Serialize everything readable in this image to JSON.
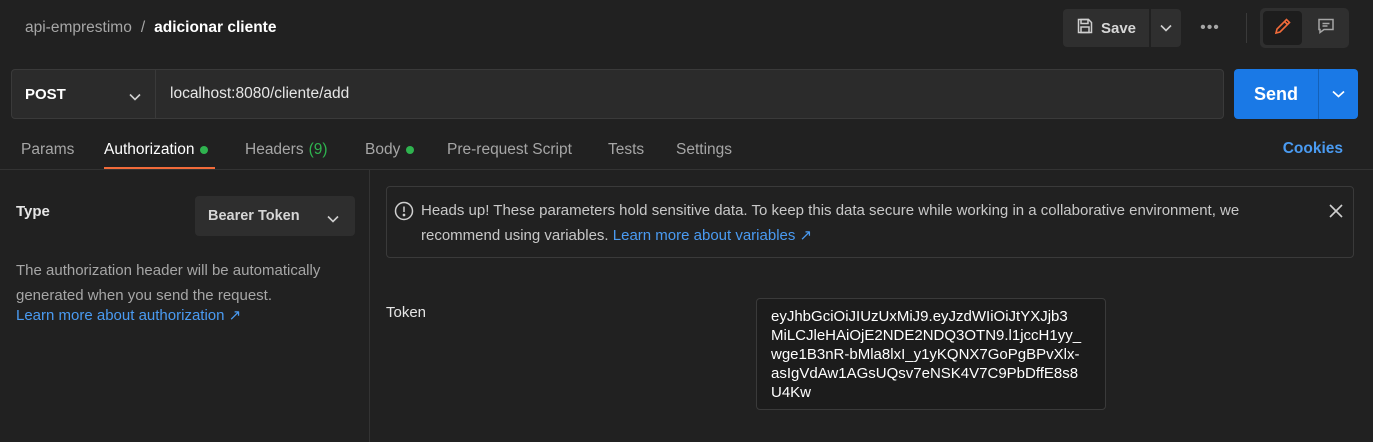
{
  "breadcrumb": {
    "parent": "api-emprestimo",
    "separator": "/",
    "current": "adicionar cliente"
  },
  "toolbar": {
    "save_label": "Save",
    "more_label": "•••"
  },
  "request": {
    "method": "POST",
    "url": "localhost:8080/cliente/add",
    "send_label": "Send"
  },
  "tabs": [
    {
      "label": "Params"
    },
    {
      "label": "Authorization",
      "dot": true
    },
    {
      "label": "Headers",
      "count": "(9)"
    },
    {
      "label": "Body",
      "dot": true
    },
    {
      "label": "Pre-request Script"
    },
    {
      "label": "Tests"
    },
    {
      "label": "Settings"
    }
  ],
  "cookies_label": "Cookies",
  "auth": {
    "type_label": "Type",
    "type_value": "Bearer Token",
    "description": "The authorization header will be automatically generated when you send the request.",
    "learn_link": "Learn more about authorization ↗"
  },
  "alert": {
    "text": "Heads up! These parameters hold sensitive data. To keep this data secure while working in a collaborative environment, we recommend using variables.",
    "link": "Learn more about variables ↗"
  },
  "token": {
    "label": "Token",
    "lines": [
      "eyJhbGciOiJIUzUxMiJ9.eyJzdWIiOiJtYXJjb3",
      "MiLCJleHAiOjE2NDE2NDQ3OTN9.l1jccH1yy_",
      "wge1B3nR-bMla8lxI_y1yKQNX7GoPgBPvXlx-",
      "asIgVdAw1AGsUQsv7eNSK4V7C9PbDffE8s8",
      "U4Kw"
    ]
  },
  "colors": {
    "accent": "#1a79e6",
    "tab_underline": "#f26b3a",
    "dot": "#2fb34f",
    "link": "#4a9bf2"
  }
}
